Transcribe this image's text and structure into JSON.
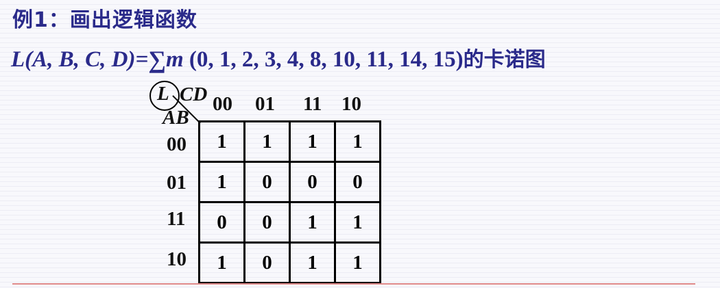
{
  "title": "例1：画出逻辑函数",
  "formula": {
    "lhs": "L(A, B, C, D)=",
    "sigma": "∑",
    "m": "m",
    "minterms": "(0, 1, 2, 3, 4, 8, 10, 11, 14, 15)",
    "suffix": "的卡诺图"
  },
  "kmap": {
    "corner_label": "L",
    "cd_label": "CD",
    "ab_label": "AB",
    "col_headers": [
      "00",
      "01",
      "11",
      "10"
    ],
    "row_headers": [
      "00",
      "01",
      "11",
      "10"
    ],
    "cells": [
      [
        "1",
        "1",
        "1",
        "1"
      ],
      [
        "1",
        "0",
        "0",
        "0"
      ],
      [
        "0",
        "0",
        "1",
        "1"
      ],
      [
        "1",
        "0",
        "1",
        "1"
      ]
    ]
  }
}
